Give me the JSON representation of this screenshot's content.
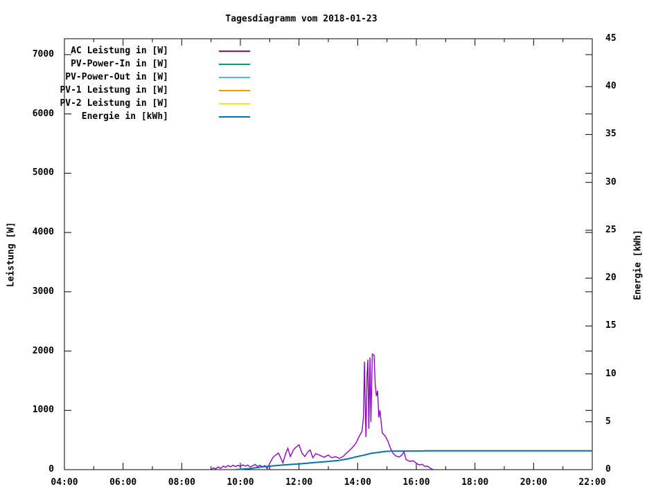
{
  "title": "Tagesdiagramm vom 2018-01-23",
  "chart_data": {
    "type": "line",
    "title": "Tagesdiagramm vom 2018-01-23",
    "grid": false,
    "legend_position": "top-left-inside",
    "x_axis": {
      "unit": "time",
      "range_hours": [
        4,
        22
      ],
      "major_tick_step_hours": 2,
      "minor_tick_step_hours": 1,
      "tick_labels": [
        "04:00",
        "06:00",
        "08:00",
        "10:00",
        "12:00",
        "14:00",
        "16:00",
        "18:00",
        "20:00",
        "22:00"
      ]
    },
    "y_axis": {
      "label": "Leistung [W]",
      "range": [
        0,
        7268
      ],
      "tick_step": 1000,
      "ticks": [
        0,
        1000,
        2000,
        3000,
        4000,
        5000,
        6000,
        7000
      ],
      "tick_labels": [
        "0",
        "1000",
        "2000",
        "3000",
        "4000",
        "5000",
        "6000",
        "7000"
      ]
    },
    "y2_axis": {
      "label": "Energie [kWh]",
      "range": [
        0,
        45
      ],
      "tick_step": 5,
      "ticks": [
        0,
        5,
        10,
        15,
        20,
        25,
        30,
        35,
        40,
        45
      ],
      "tick_labels": [
        "0",
        "5",
        "10",
        "15",
        "20",
        "25",
        "30",
        "35",
        "40",
        "45"
      ]
    },
    "series": [
      {
        "label": "AC Leistung in [W]",
        "color": "#9400d3",
        "axis": "y1",
        "points": [
          [
            9.02,
            5
          ],
          [
            9.08,
            30
          ],
          [
            9.15,
            12
          ],
          [
            9.25,
            45
          ],
          [
            9.33,
            22
          ],
          [
            9.42,
            60
          ],
          [
            9.5,
            38
          ],
          [
            9.58,
            70
          ],
          [
            9.67,
            48
          ],
          [
            9.75,
            75
          ],
          [
            9.83,
            52
          ],
          [
            9.92,
            72
          ],
          [
            10.0,
            55
          ],
          [
            10.08,
            80
          ],
          [
            10.17,
            60
          ],
          [
            10.25,
            78
          ],
          [
            10.33,
            45
          ],
          [
            10.42,
            65
          ],
          [
            10.5,
            88
          ],
          [
            10.58,
            55
          ],
          [
            10.67,
            75
          ],
          [
            10.75,
            48
          ],
          [
            10.83,
            70
          ],
          [
            10.92,
            18
          ],
          [
            11.0,
            105
          ],
          [
            11.1,
            200
          ],
          [
            11.2,
            245
          ],
          [
            11.3,
            280
          ],
          [
            11.45,
            115
          ],
          [
            11.55,
            280
          ],
          [
            11.62,
            360
          ],
          [
            11.7,
            220
          ],
          [
            11.82,
            340
          ],
          [
            11.9,
            380
          ],
          [
            12.0,
            420
          ],
          [
            12.1,
            280
          ],
          [
            12.2,
            220
          ],
          [
            12.3,
            300
          ],
          [
            12.38,
            330
          ],
          [
            12.47,
            200
          ],
          [
            12.57,
            270
          ],
          [
            12.7,
            245
          ],
          [
            12.85,
            210
          ],
          [
            13.0,
            245
          ],
          [
            13.12,
            200
          ],
          [
            13.25,
            220
          ],
          [
            13.37,
            190
          ],
          [
            13.5,
            220
          ],
          [
            13.62,
            280
          ],
          [
            13.75,
            340
          ],
          [
            13.85,
            390
          ],
          [
            13.95,
            455
          ],
          [
            14.05,
            560
          ],
          [
            14.15,
            650
          ],
          [
            14.2,
            900
          ],
          [
            14.23,
            1820
          ],
          [
            14.28,
            550
          ],
          [
            14.32,
            1600
          ],
          [
            14.35,
            1855
          ],
          [
            14.38,
            690
          ],
          [
            14.42,
            1895
          ],
          [
            14.45,
            800
          ],
          [
            14.5,
            1950
          ],
          [
            14.56,
            1930
          ],
          [
            14.6,
            1430
          ],
          [
            14.64,
            1240
          ],
          [
            14.68,
            1330
          ],
          [
            14.72,
            880
          ],
          [
            14.76,
            1000
          ],
          [
            14.8,
            800
          ],
          [
            14.84,
            620
          ],
          [
            14.95,
            560
          ],
          [
            15.03,
            480
          ],
          [
            15.12,
            360
          ],
          [
            15.2,
            280
          ],
          [
            15.3,
            230
          ],
          [
            15.42,
            215
          ],
          [
            15.5,
            240
          ],
          [
            15.58,
            300
          ],
          [
            15.65,
            170
          ],
          [
            15.78,
            140
          ],
          [
            15.9,
            150
          ],
          [
            16.02,
            100
          ],
          [
            16.1,
            80
          ],
          [
            16.2,
            90
          ],
          [
            16.29,
            55
          ],
          [
            16.38,
            60
          ],
          [
            16.49,
            20
          ],
          [
            16.57,
            5
          ]
        ]
      },
      {
        "label": "PV-Power-In in [W]",
        "color": "#009e73",
        "axis": "y1",
        "points": []
      },
      {
        "label": "PV-Power-Out in [W]",
        "color": "#56b4e9",
        "axis": "y1",
        "points": []
      },
      {
        "label": "PV-1 Leistung in [W]",
        "color": "#e69f00",
        "axis": "y1",
        "points": []
      },
      {
        "label": "PV-2 Leistung in [W]",
        "color": "#f0e442",
        "axis": "y1",
        "points": []
      },
      {
        "label": "Energie in [kWh]",
        "color": "#0072b2",
        "axis": "y2",
        "points": [
          [
            9.85,
            0.01
          ],
          [
            10.3,
            0.11
          ],
          [
            10.8,
            0.3
          ],
          [
            11.25,
            0.43
          ],
          [
            11.7,
            0.54
          ],
          [
            12.0,
            0.6
          ],
          [
            12.45,
            0.72
          ],
          [
            12.9,
            0.83
          ],
          [
            13.37,
            0.97
          ],
          [
            13.7,
            1.15
          ],
          [
            14.0,
            1.37
          ],
          [
            14.2,
            1.5
          ],
          [
            14.45,
            1.7
          ],
          [
            14.7,
            1.8
          ],
          [
            14.92,
            1.89
          ],
          [
            15.15,
            1.93
          ],
          [
            16.25,
            1.95
          ],
          [
            16.3,
            1.97
          ],
          [
            22.0,
            1.97
          ]
        ]
      }
    ]
  }
}
